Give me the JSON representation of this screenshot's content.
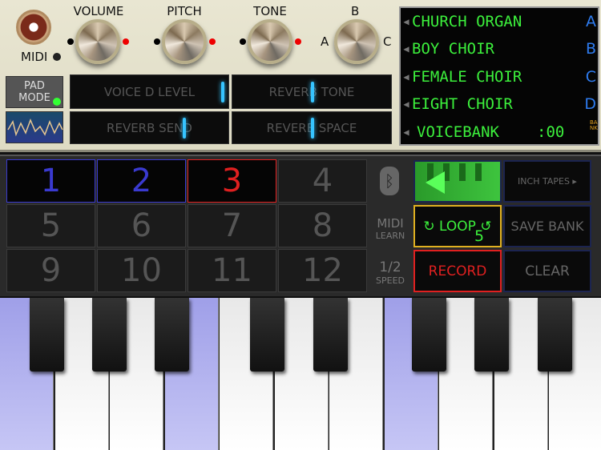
{
  "knobs": {
    "volume": "VOLUME",
    "pitch": "PITCH",
    "tone": "TONE",
    "b": "B",
    "a": "A",
    "c": "C"
  },
  "midi_label": "MIDI",
  "pad_mode": {
    "line1": "PAD",
    "line2": "MODE"
  },
  "sliders": [
    {
      "label": "VOICE D LEVEL",
      "value": 0.9
    },
    {
      "label": "REVERB TONE",
      "value": 0.5
    },
    {
      "label": "REVERB SEND",
      "value": 0.72
    },
    {
      "label": "REVERB SPACE",
      "value": 0.5
    }
  ],
  "display": {
    "rows": [
      {
        "name": "CHURCH ORGAN",
        "letter": "A"
      },
      {
        "name": "BOY CHOIR",
        "letter": "B"
      },
      {
        "name": "FEMALE CHOIR",
        "letter": "C"
      },
      {
        "name": "EIGHT CHOIR",
        "letter": "D"
      }
    ],
    "voicebank": "VOICEBANK",
    "bank_number": ":00",
    "bank_label": "BANK",
    "text_color": "#3cf03c",
    "letter_color": "#2e7cf0"
  },
  "pads": [
    "1",
    "2",
    "3",
    "4",
    "5",
    "6",
    "7",
    "8",
    "9",
    "10",
    "11",
    "12"
  ],
  "pad_colors": {
    "1": "#3a3ad0",
    "2": "#3a3ad0",
    "3": "#e02020"
  },
  "side": {
    "midi": "MIDI",
    "learn": "LEARN",
    "half": "1/2",
    "speed": "SPEED"
  },
  "buttons": {
    "inch_tapes": "INCH TAPES ▸",
    "loop": "↻ LOOP ↺",
    "loop_count": "5",
    "save_bank": "SAVE BANK",
    "record": "RECORD",
    "clear": "CLEAR"
  }
}
